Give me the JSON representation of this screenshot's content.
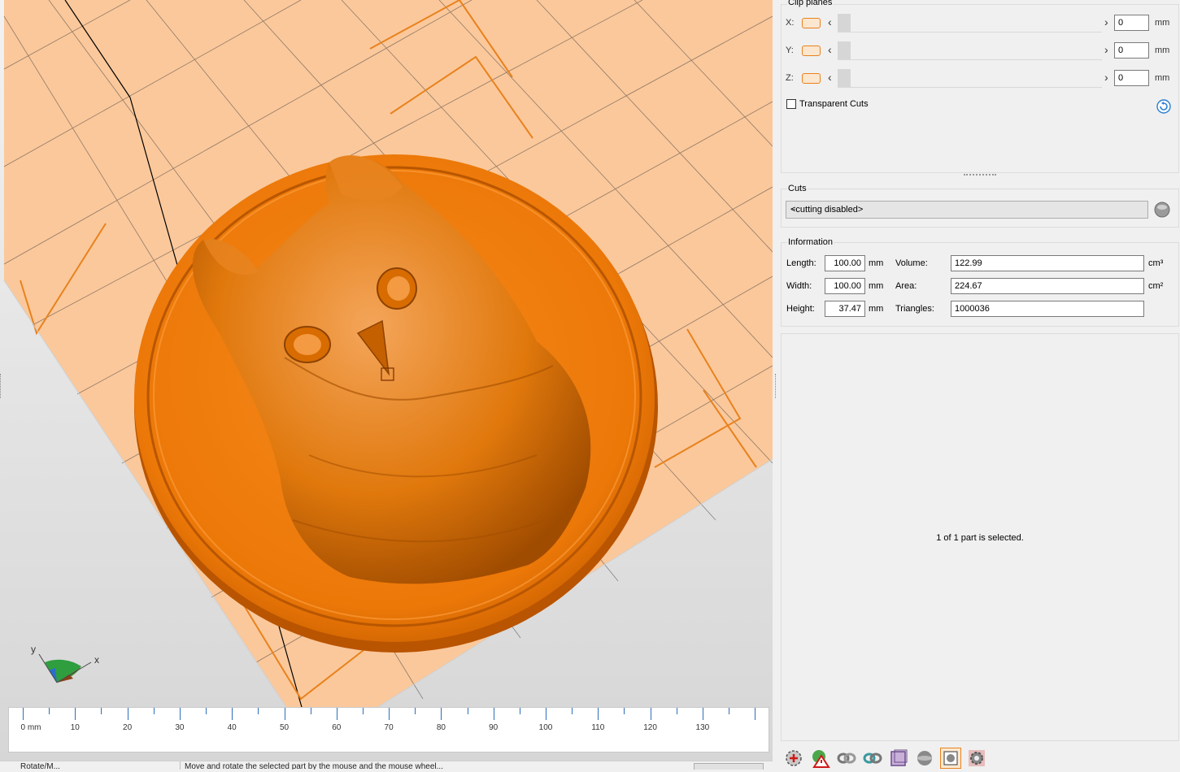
{
  "viewport": {
    "ruler": {
      "unit_label": "0 mm",
      "labels": [
        "10",
        "20",
        "30",
        "40",
        "50",
        "60",
        "70",
        "80",
        "90",
        "100",
        "110",
        "120",
        "130"
      ]
    },
    "axes": {
      "x": "x",
      "y": "y"
    },
    "statusbar": {
      "mode": "Rotate/M...",
      "hint": "Move and rotate the selected part by the mouse and the mouse wheel..."
    }
  },
  "clip_planes": {
    "title": "Clip planes",
    "rows": [
      {
        "axis": "X:",
        "value": "0",
        "unit": "mm"
      },
      {
        "axis": "Y:",
        "value": "0",
        "unit": "mm"
      },
      {
        "axis": "Z:",
        "value": "0",
        "unit": "mm"
      }
    ],
    "transparent_cuts_label": "Transparent Cuts",
    "transparent_cuts_checked": false
  },
  "cuts": {
    "title": "Cuts",
    "selected": "<cutting disabled>"
  },
  "information": {
    "title": "Information",
    "length_label": "Length:",
    "length": "100.00",
    "length_unit": "mm",
    "width_label": "Width:",
    "width": "100.00",
    "width_unit": "mm",
    "height_label": "Height:",
    "height": "37.47",
    "height_unit": "mm",
    "volume_label": "Volume:",
    "volume": "122.99",
    "volume_unit": "cm³",
    "area_label": "Area:",
    "area": "224.67",
    "area_unit": "cm²",
    "triangles_label": "Triangles:",
    "triangles": "1000036"
  },
  "selection_message": "1 of 1 part is selected.",
  "toolbar": {
    "icons": [
      "add-part-icon",
      "warning-icon",
      "repair-icon",
      "link-icon",
      "link-alt-icon",
      "box-icon",
      "sphere-icon",
      "select-icon",
      "settings-icon"
    ]
  },
  "colors": {
    "model": "#f07d0a",
    "platform": "#fbc79a",
    "accent": "#e8821e"
  }
}
